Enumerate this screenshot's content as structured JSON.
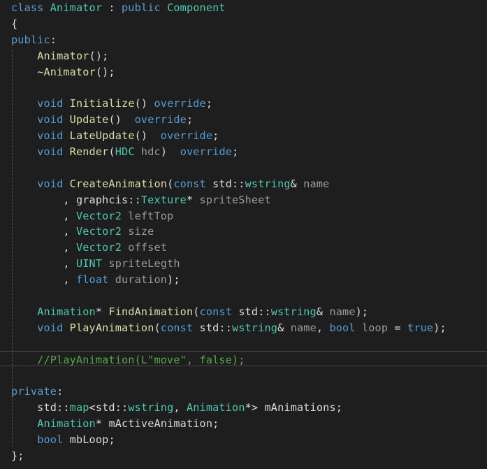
{
  "editor": {
    "theme": "dark",
    "colors": {
      "background": "#1e1e1e",
      "keyword": "#569cd6",
      "type": "#4ec9b0",
      "function": "#dcdcaa",
      "plain": "#dcdcdc",
      "parameter": "#9a9a9a",
      "comment": "#57a64a"
    },
    "lines": [
      [
        {
          "t": "class",
          "c": "kw"
        },
        {
          "t": " "
        },
        {
          "t": "Animator",
          "c": "ty"
        },
        {
          "t": " : "
        },
        {
          "t": "public",
          "c": "kw"
        },
        {
          "t": " "
        },
        {
          "t": "Component",
          "c": "ty"
        }
      ],
      [
        {
          "t": "{"
        }
      ],
      [
        {
          "t": "public",
          "c": "kw"
        },
        {
          "t": ":"
        }
      ],
      [
        {
          "t": "    "
        },
        {
          "t": "Animator",
          "c": "fn"
        },
        {
          "t": "();"
        }
      ],
      [
        {
          "t": "    ~"
        },
        {
          "t": "Animator",
          "c": "fn"
        },
        {
          "t": "();"
        }
      ],
      [
        {
          "t": ""
        }
      ],
      [
        {
          "t": "    "
        },
        {
          "t": "void",
          "c": "kw"
        },
        {
          "t": " "
        },
        {
          "t": "Initialize",
          "c": "fn"
        },
        {
          "t": "() "
        },
        {
          "t": "override",
          "c": "kw"
        },
        {
          "t": ";"
        }
      ],
      [
        {
          "t": "    "
        },
        {
          "t": "void",
          "c": "kw"
        },
        {
          "t": " "
        },
        {
          "t": "Update",
          "c": "fn"
        },
        {
          "t": "()  "
        },
        {
          "t": "override",
          "c": "kw"
        },
        {
          "t": ";"
        }
      ],
      [
        {
          "t": "    "
        },
        {
          "t": "void",
          "c": "kw"
        },
        {
          "t": " "
        },
        {
          "t": "LateUpdate",
          "c": "fn"
        },
        {
          "t": "()  "
        },
        {
          "t": "override",
          "c": "kw"
        },
        {
          "t": ";"
        }
      ],
      [
        {
          "t": "    "
        },
        {
          "t": "void",
          "c": "kw"
        },
        {
          "t": " "
        },
        {
          "t": "Render",
          "c": "fn"
        },
        {
          "t": "("
        },
        {
          "t": "HDC",
          "c": "ty"
        },
        {
          "t": " "
        },
        {
          "t": "hdc",
          "c": "pa"
        },
        {
          "t": ")  "
        },
        {
          "t": "override",
          "c": "kw"
        },
        {
          "t": ";"
        }
      ],
      [
        {
          "t": ""
        }
      ],
      [
        {
          "t": "    "
        },
        {
          "t": "void",
          "c": "kw"
        },
        {
          "t": " "
        },
        {
          "t": "CreateAnimation",
          "c": "fn"
        },
        {
          "t": "("
        },
        {
          "t": "const",
          "c": "kw"
        },
        {
          "t": " std::"
        },
        {
          "t": "wstring",
          "c": "ty"
        },
        {
          "t": "& "
        },
        {
          "t": "name",
          "c": "pa"
        }
      ],
      [
        {
          "t": "        , "
        },
        {
          "t": "graphcis",
          "c": "pl"
        },
        {
          "t": "::"
        },
        {
          "t": "Texture",
          "c": "ty"
        },
        {
          "t": "* "
        },
        {
          "t": "spriteSheet",
          "c": "pa"
        }
      ],
      [
        {
          "t": "        , "
        },
        {
          "t": "Vector2",
          "c": "ty"
        },
        {
          "t": " "
        },
        {
          "t": "leftTop",
          "c": "pa"
        }
      ],
      [
        {
          "t": "        , "
        },
        {
          "t": "Vector2",
          "c": "ty"
        },
        {
          "t": " "
        },
        {
          "t": "size",
          "c": "pa"
        }
      ],
      [
        {
          "t": "        , "
        },
        {
          "t": "Vector2",
          "c": "ty"
        },
        {
          "t": " "
        },
        {
          "t": "offset",
          "c": "pa"
        }
      ],
      [
        {
          "t": "        , "
        },
        {
          "t": "UINT",
          "c": "ty"
        },
        {
          "t": " "
        },
        {
          "t": "spriteLegth",
          "c": "pa"
        }
      ],
      [
        {
          "t": "        , "
        },
        {
          "t": "float",
          "c": "kw"
        },
        {
          "t": " "
        },
        {
          "t": "duration",
          "c": "pa"
        },
        {
          "t": ");"
        }
      ],
      [
        {
          "t": ""
        }
      ],
      [
        {
          "t": "    "
        },
        {
          "t": "Animation",
          "c": "ty"
        },
        {
          "t": "* "
        },
        {
          "t": "FindAnimation",
          "c": "fn"
        },
        {
          "t": "("
        },
        {
          "t": "const",
          "c": "kw"
        },
        {
          "t": " std::"
        },
        {
          "t": "wstring",
          "c": "ty"
        },
        {
          "t": "& "
        },
        {
          "t": "name",
          "c": "pa"
        },
        {
          "t": ");"
        }
      ],
      [
        {
          "t": "    "
        },
        {
          "t": "void",
          "c": "kw"
        },
        {
          "t": " "
        },
        {
          "t": "PlayAnimation",
          "c": "fn"
        },
        {
          "t": "("
        },
        {
          "t": "const",
          "c": "kw"
        },
        {
          "t": " std::"
        },
        {
          "t": "wstring",
          "c": "ty"
        },
        {
          "t": "& "
        },
        {
          "t": "name",
          "c": "pa"
        },
        {
          "t": ", "
        },
        {
          "t": "bool",
          "c": "kw"
        },
        {
          "t": " "
        },
        {
          "t": "loop",
          "c": "pa"
        },
        {
          "t": " = "
        },
        {
          "t": "true",
          "c": "kw"
        },
        {
          "t": ");"
        }
      ],
      [
        {
          "t": ""
        }
      ],
      [
        {
          "t": "    //PlayAnimation(L\"move\", false);",
          "c": "cm"
        }
      ],
      [
        {
          "t": ""
        }
      ],
      [
        {
          "t": "private",
          "c": "kw"
        },
        {
          "t": ":"
        }
      ],
      [
        {
          "t": "    std::"
        },
        {
          "t": "map",
          "c": "ty"
        },
        {
          "t": "<std::"
        },
        {
          "t": "wstring",
          "c": "ty"
        },
        {
          "t": ", "
        },
        {
          "t": "Animation",
          "c": "ty"
        },
        {
          "t": "*> "
        },
        {
          "t": "mAnimations"
        },
        {
          "t": ";"
        }
      ],
      [
        {
          "t": "    "
        },
        {
          "t": "Animation",
          "c": "ty"
        },
        {
          "t": "* "
        },
        {
          "t": "mActiveAnimation"
        },
        {
          "t": ";"
        }
      ],
      [
        {
          "t": "    "
        },
        {
          "t": "bool",
          "c": "kw"
        },
        {
          "t": " "
        },
        {
          "t": "mbLoop"
        },
        {
          "t": ";"
        }
      ],
      [
        {
          "t": "};"
        }
      ]
    ]
  }
}
